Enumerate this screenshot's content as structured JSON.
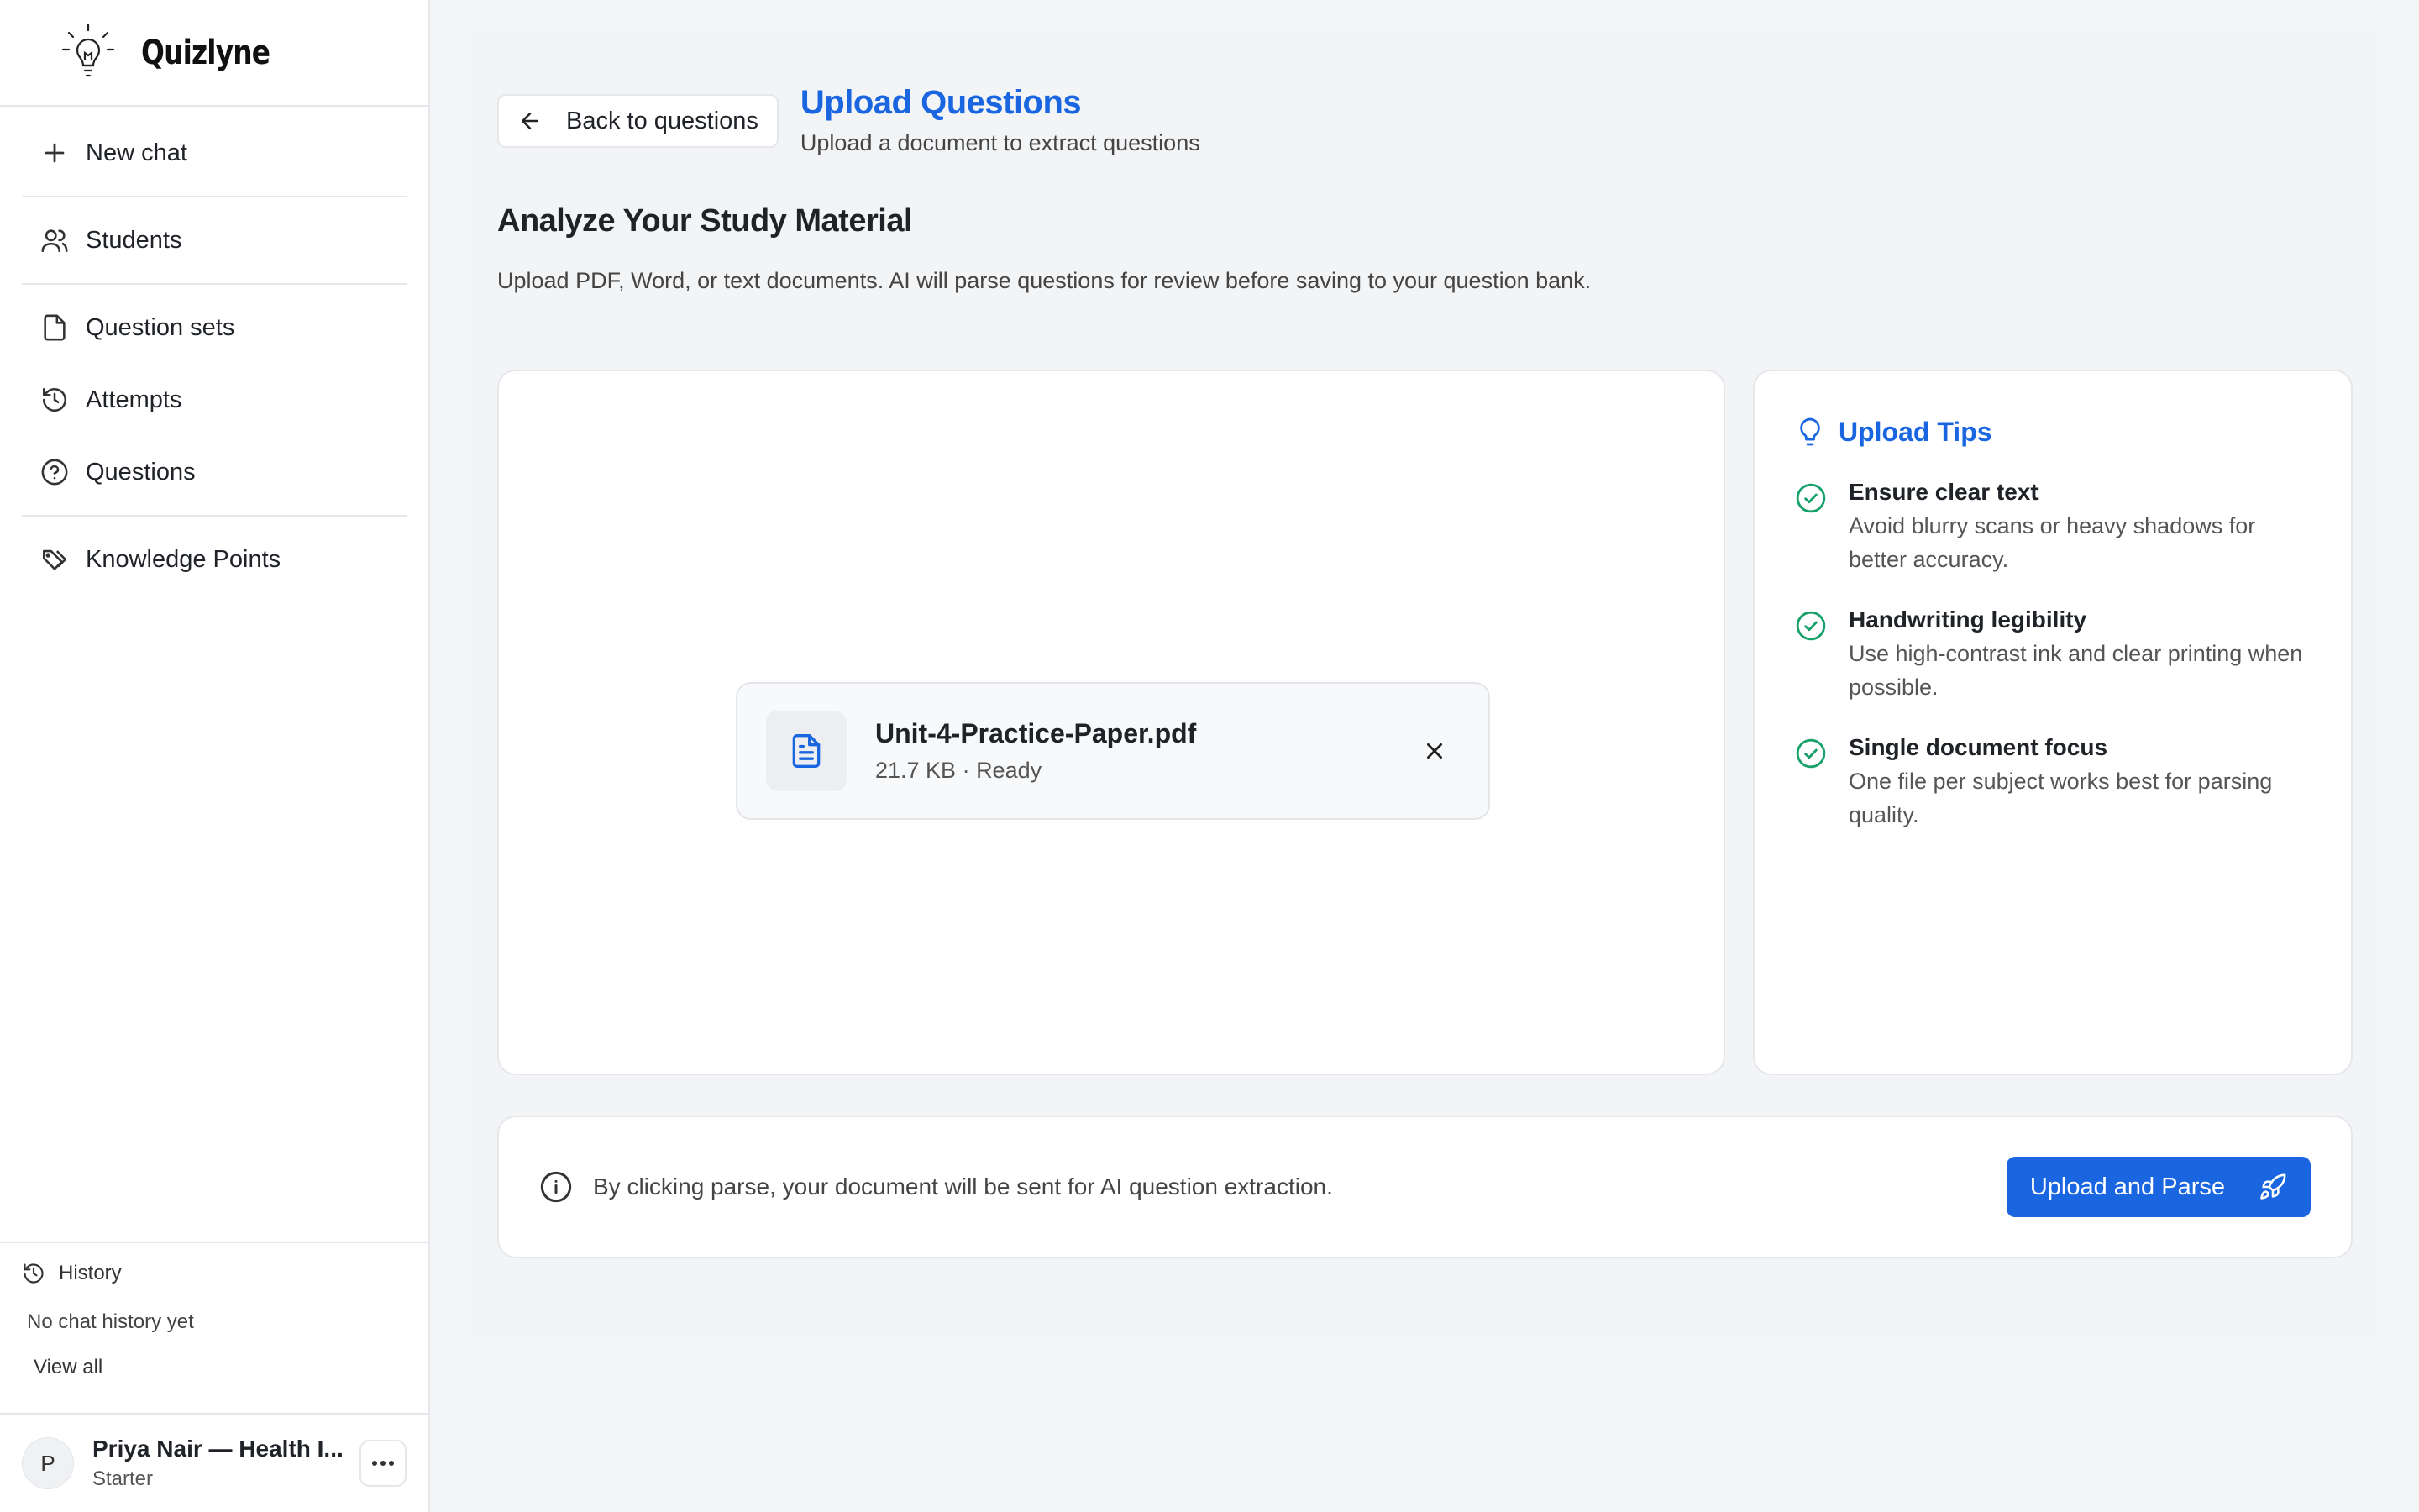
{
  "brand": {
    "name": "Quizlyne",
    "logo_icon": "lightbulb-icon"
  },
  "sidebar": {
    "items": [
      {
        "label": "New chat",
        "icon": "plus-icon"
      },
      {
        "label": "Students",
        "icon": "users-icon"
      },
      {
        "label": "Question sets",
        "icon": "file-icon"
      },
      {
        "label": "Attempts",
        "icon": "history-icon"
      },
      {
        "label": "Questions",
        "icon": "help-circle-icon"
      },
      {
        "label": "Knowledge Points",
        "icon": "tags-icon"
      }
    ],
    "history": {
      "title": "History",
      "empty_text": "No chat history yet",
      "view_all": "View all"
    },
    "user": {
      "initial": "P",
      "name": "Priya Nair — Health I...",
      "plan": "Starter"
    }
  },
  "header": {
    "back_label": "Back to questions",
    "title": "Upload Questions",
    "subtitle": "Upload a document to extract questions"
  },
  "section": {
    "title": "Analyze Your Study Material",
    "description": "Upload PDF, Word, or text documents. AI will parse questions for review before saving to your question bank."
  },
  "file": {
    "name": "Unit-4-Practice-Paper.pdf",
    "detail": "21.7 KB · Ready"
  },
  "tips": {
    "title": "Upload Tips",
    "items": [
      {
        "title": "Ensure clear text",
        "desc": "Avoid blurry scans or heavy shadows for better accuracy."
      },
      {
        "title": "Handwriting legibility",
        "desc": "Use high-contrast ink and clear printing when possible."
      },
      {
        "title": "Single document focus",
        "desc": "One file per subject works best for parsing quality."
      }
    ]
  },
  "action": {
    "note": "By clicking parse, your document will be sent for AI question extraction.",
    "button_label": "Upload and Parse"
  },
  "colors": {
    "accent": "#1a66e0",
    "success": "#16a06a",
    "background": "#f4f5f7"
  }
}
